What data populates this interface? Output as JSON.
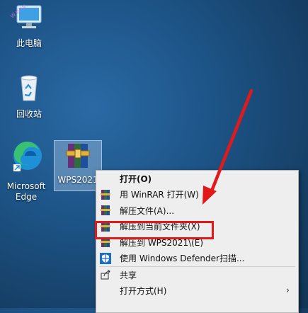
{
  "desktop": {
    "icons": [
      {
        "label": "此电脑"
      },
      {
        "label": "回收站"
      },
      {
        "label": "Microsoft Edge"
      },
      {
        "label": "WPS2021"
      }
    ]
  },
  "context_menu": {
    "items": [
      {
        "label": "打开(O)",
        "icon": "none"
      },
      {
        "label": "用 WinRAR 打开(W)",
        "icon": "winrar-icon"
      },
      {
        "label": "解压文件(A)...",
        "icon": "winrar-icon"
      },
      {
        "label": "解压到当前文件夹(X)",
        "icon": "winrar-icon"
      },
      {
        "label": "解压到 WPS2021\\(E)",
        "icon": "winrar-icon"
      },
      {
        "label": "使用 Windows Defender扫描...",
        "icon": "defender-icon"
      },
      {
        "label": "共享",
        "icon": "share-icon"
      },
      {
        "label": "打开方式(H)",
        "icon": "none"
      }
    ]
  },
  "colors": {
    "desktop_bg": "#1d5487",
    "annotation_red": "#e21919",
    "menu_bg": "#eeeeee"
  }
}
